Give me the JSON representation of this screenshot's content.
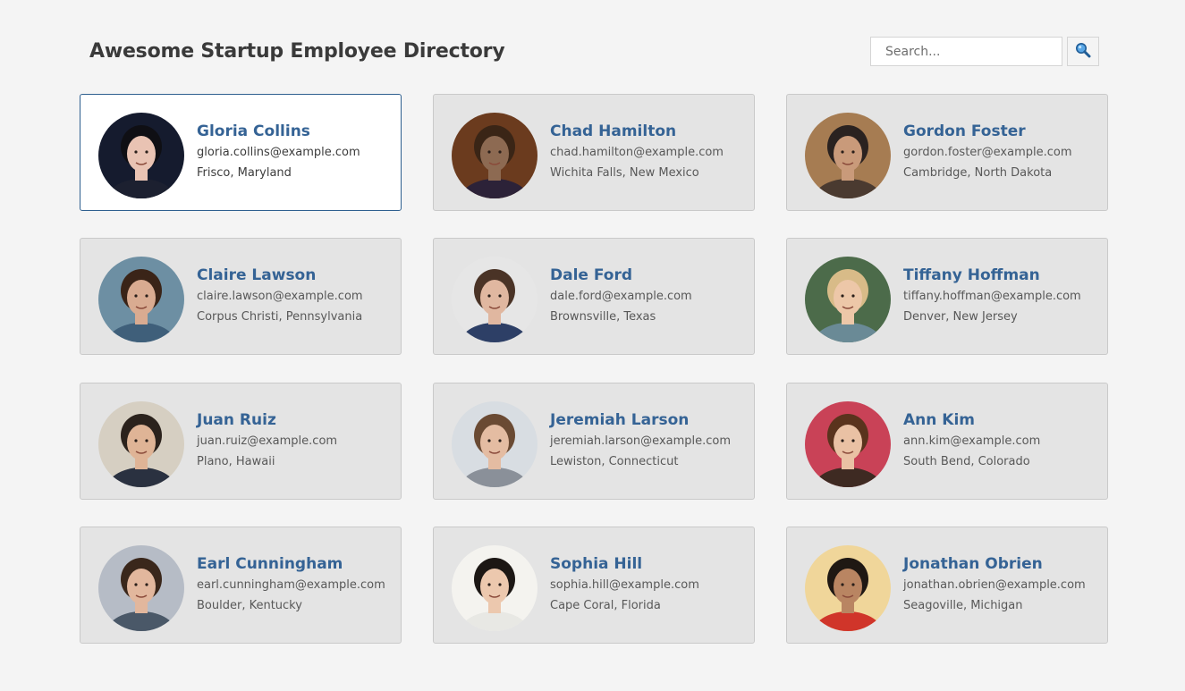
{
  "header": {
    "title": "Awesome Startup Employee Directory",
    "search_placeholder": "Search...",
    "search_icon": "magnifier-icon"
  },
  "employees": [
    {
      "name": "Gloria Collins",
      "email": "gloria.collins@example.com",
      "location": "Frisco, Maryland",
      "active": true,
      "avatar_bg": "#151b2e",
      "skin": "#e9c3b3",
      "hair": "#0f0f14",
      "shirt": "#1c2030"
    },
    {
      "name": "Chad Hamilton",
      "email": "chad.hamilton@example.com",
      "location": "Wichita Falls, New Mexico",
      "active": false,
      "avatar_bg": "#6b3b1e",
      "skin": "#8d6a52",
      "hair": "#3a2516",
      "shirt": "#2c2238"
    },
    {
      "name": "Gordon Foster",
      "email": "gordon.foster@example.com",
      "location": "Cambridge, North Dakota",
      "active": false,
      "avatar_bg": "#a67c52",
      "skin": "#c99a7a",
      "hair": "#2a2220",
      "shirt": "#4a3a30"
    },
    {
      "name": "Claire Lawson",
      "email": "claire.lawson@example.com",
      "location": "Corpus Christi, Pennsylvania",
      "active": false,
      "avatar_bg": "#6d8fa3",
      "skin": "#d9ab91",
      "hair": "#3a2418",
      "shirt": "#3f5f7a"
    },
    {
      "name": "Dale Ford",
      "email": "dale.ford@example.com",
      "location": "Brownsville, Texas",
      "active": false,
      "avatar_bg": "#e6e6e6",
      "skin": "#e0b7a0",
      "hair": "#4a3326",
      "shirt": "#2d3f66"
    },
    {
      "name": "Tiffany Hoffman",
      "email": "tiffany.hoffman@example.com",
      "location": "Denver, New Jersey",
      "active": false,
      "avatar_bg": "#4c6b4a",
      "skin": "#edc7a8",
      "hair": "#d8bb88",
      "shirt": "#6a8a96"
    },
    {
      "name": "Juan Ruiz",
      "email": "juan.ruiz@example.com",
      "location": "Plano, Hawaii",
      "active": false,
      "avatar_bg": "#d6cfc2",
      "skin": "#dfb496",
      "hair": "#2b221c",
      "shirt": "#2a3140"
    },
    {
      "name": "Jeremiah Larson",
      "email": "jeremiah.larson@example.com",
      "location": "Lewiston, Connecticut",
      "active": false,
      "avatar_bg": "#d8dde2",
      "skin": "#e4bca2",
      "hair": "#6a4a33",
      "shirt": "#8a9099"
    },
    {
      "name": "Ann Kim",
      "email": "ann.kim@example.com",
      "location": "South Bend, Colorado",
      "active": false,
      "avatar_bg": "#c94257",
      "skin": "#eac1a4",
      "hair": "#5a331d",
      "shirt": "#3e2a22"
    },
    {
      "name": "Earl Cunningham",
      "email": "earl.cunningham@example.com",
      "location": "Boulder, Kentucky",
      "active": false,
      "avatar_bg": "#b6bcc6",
      "skin": "#e2b79d",
      "hair": "#3a271b",
      "shirt": "#4a5868"
    },
    {
      "name": "Sophia Hill",
      "email": "sophia.hill@example.com",
      "location": "Cape Coral, Florida",
      "active": false,
      "avatar_bg": "#f4f3ef",
      "skin": "#ecc8ae",
      "hair": "#1c1714",
      "shirt": "#e8e8e4"
    },
    {
      "name": "Jonathan Obrien",
      "email": "jonathan.obrien@example.com",
      "location": "Seagoville, Michigan",
      "active": false,
      "avatar_bg": "#f0d69a",
      "skin": "#b98562",
      "hair": "#1f1813",
      "shirt": "#d0352a"
    }
  ]
}
